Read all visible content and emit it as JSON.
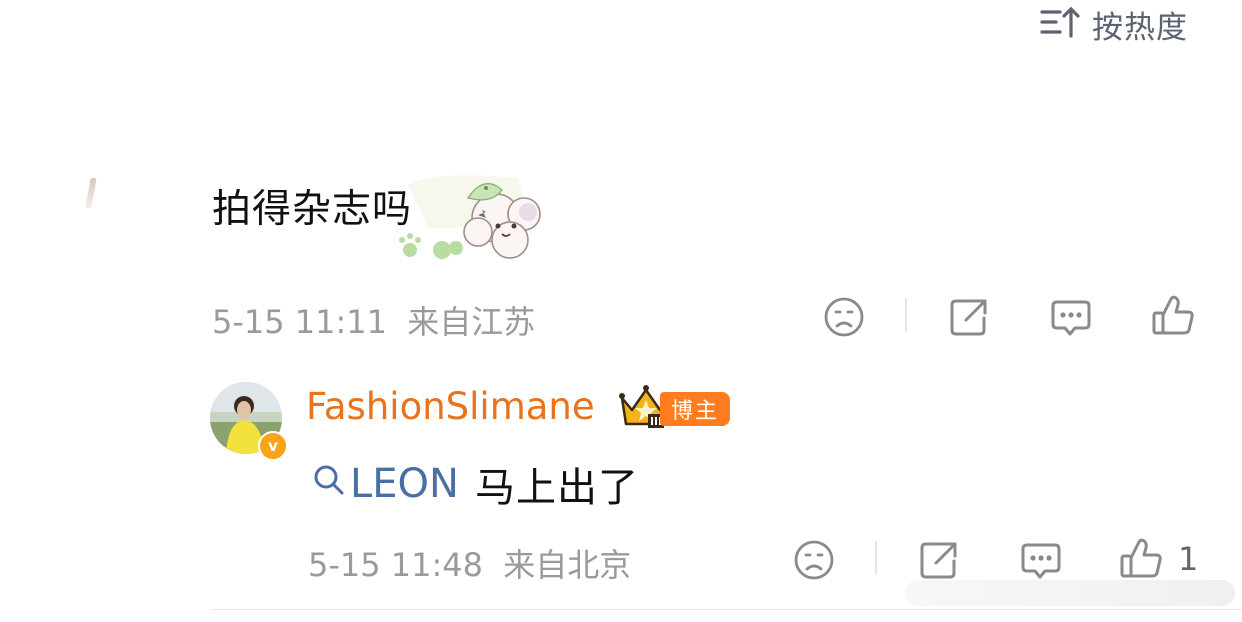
{
  "sort": {
    "label": "按热度",
    "icon": "sort-desc-icon"
  },
  "comment": {
    "text": "拍得杂志吗",
    "sticker": "cartoon-sticker",
    "timestamp": "5-15 11:11",
    "location": "来自江苏",
    "actions": [
      "dislike-icon",
      "share-icon",
      "reply-icon",
      "like-icon"
    ]
  },
  "reply": {
    "username": "FashionSlimane",
    "level_badge": "crown-badge",
    "role_badge": "博主",
    "verified_badge": "v",
    "link_text": "LEON",
    "text": "马上出了",
    "timestamp": "5-15 11:48",
    "location": "来自北京",
    "like_count": "1",
    "actions": [
      "dislike-icon",
      "share-icon",
      "reply-icon",
      "like-icon"
    ]
  },
  "colors": {
    "username": "#e8731a",
    "link": "#4a6fa5",
    "meta": "#9a9a9a",
    "icon": "#8a8a8a",
    "badge": "#ff7d1f"
  }
}
